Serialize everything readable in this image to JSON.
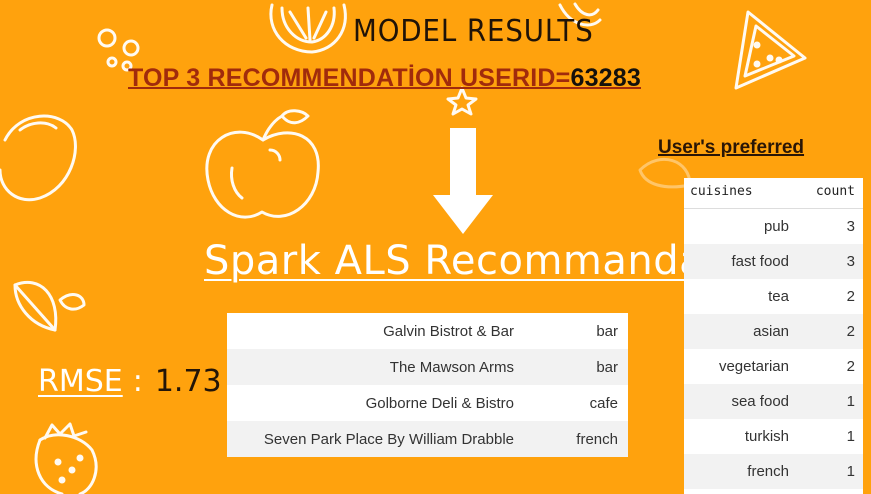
{
  "header": {
    "title": "MODEL RESULTS",
    "subtitle_prefix": "TOP 3 RECOMMENDATİON USERID=",
    "user_id": "63283"
  },
  "model": {
    "name": "Spark ALS Recommandation",
    "rmse_label": "RMSE",
    "rmse_separator": ":",
    "rmse_value": "1.73"
  },
  "recommendations": [
    {
      "name": "Galvin Bistrot & Bar",
      "type": "bar"
    },
    {
      "name": "The Mawson Arms",
      "type": "bar"
    },
    {
      "name": "Golborne Deli & Bistro",
      "type": "cafe"
    },
    {
      "name": "Seven Park Place By William Drabble",
      "type": "french"
    }
  ],
  "preferences": {
    "title": "User's preferred",
    "columns": [
      "cuisines",
      "count"
    ],
    "rows": [
      {
        "cuisine": "pub",
        "count": "3"
      },
      {
        "cuisine": "fast food",
        "count": "3"
      },
      {
        "cuisine": "tea",
        "count": "2"
      },
      {
        "cuisine": "asian",
        "count": "2"
      },
      {
        "cuisine": "vegetarian",
        "count": "2"
      },
      {
        "cuisine": "sea food",
        "count": "1"
      },
      {
        "cuisine": "turkish",
        "count": "1"
      },
      {
        "cuisine": "french",
        "count": "1"
      }
    ]
  },
  "colors": {
    "background": "#ffa20d",
    "subtitle": "#a12b0c",
    "text_dark": "#1f1308",
    "doodle": "#ffffff"
  }
}
